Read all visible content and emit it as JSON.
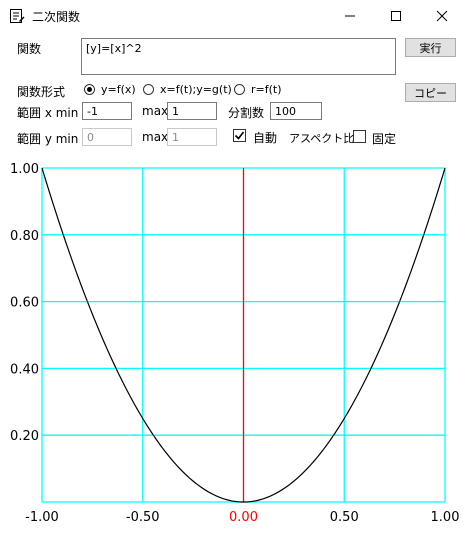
{
  "window": {
    "title": "二次関数",
    "icon": "notepad-icon"
  },
  "form": {
    "function_label": "関数",
    "function_value": "[y]=[x]^2",
    "execute_label": "実行",
    "copy_label": "コピー",
    "format_label": "関数形式",
    "format_options": [
      "y=f(x)",
      "x=f(t);y=g(t)",
      "r=f(t)"
    ],
    "format_selected": 0,
    "xrange_label": "範囲 x min",
    "xmin": "-1",
    "xmax_label": "max",
    "xmax": "1",
    "divisions_label": "分割数",
    "divisions": "100",
    "yrange_label": "範囲 y min",
    "ymin": "0",
    "ymax_label": "max",
    "ymax": "1",
    "auto_label": "自動",
    "auto_checked": true,
    "aspect_label": "アスペクト比",
    "fixed_label": "固定",
    "fixed_checked": false
  },
  "chart_data": {
    "type": "line",
    "function": "y = x^2",
    "xlim": [
      -1,
      1
    ],
    "ylim": [
      0,
      1
    ],
    "x_ticks": [
      "-1.00",
      "-0.50",
      "0.00",
      "0.50",
      "1.00"
    ],
    "x_tick_values": [
      -1,
      -0.5,
      0,
      0.5,
      1
    ],
    "y_ticks": [
      "1.00",
      "0.80",
      "0.60",
      "0.40",
      "0.20"
    ],
    "y_tick_values": [
      1,
      0.8,
      0.6,
      0.4,
      0.2
    ],
    "grid": true,
    "colors": {
      "grid": "#00ffff",
      "zero_axis": "#ff0000",
      "zero_tick_label": "#ff0000",
      "curve": "#000000"
    },
    "series": [
      {
        "x": [
          -1,
          -0.9,
          -0.8,
          -0.7,
          -0.6,
          -0.5,
          -0.4,
          -0.3,
          -0.2,
          -0.1,
          0,
          0.1,
          0.2,
          0.3,
          0.4,
          0.5,
          0.6,
          0.7,
          0.8,
          0.9,
          1
        ],
        "y": [
          1,
          0.81,
          0.64,
          0.49,
          0.36,
          0.25,
          0.16,
          0.09,
          0.04,
          0.01,
          0,
          0.01,
          0.04,
          0.09,
          0.16,
          0.25,
          0.36,
          0.49,
          0.64,
          0.81,
          1
        ]
      }
    ]
  }
}
